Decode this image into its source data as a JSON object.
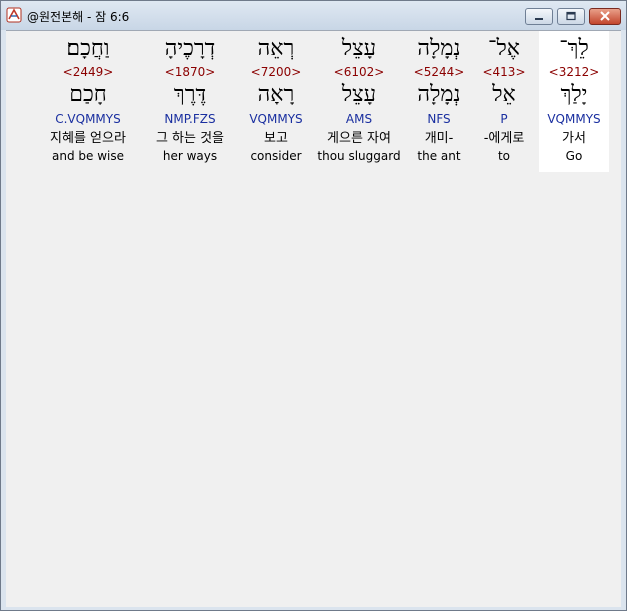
{
  "window": {
    "title": "@원전본해 - 잠 6:6",
    "icon": "app-logo-icon",
    "buttons": [
      "minimize-icon",
      "maximize-icon",
      "close-icon"
    ]
  },
  "colors": {
    "strong": "#8b0000",
    "morph": "#1a2fa0",
    "selected_bg": "#ffffff"
  },
  "words": [
    {
      "hebrew": "לֵךְ־",
      "strong": "<3212>",
      "lemma": "יָלַךְ",
      "morph": "VQMMYS",
      "korean": "가서",
      "english": "Go",
      "selected": true
    },
    {
      "hebrew": "אֶל־",
      "strong": "<413>",
      "lemma": "אֵל",
      "morph": "P",
      "korean": "-에게로",
      "english": "to",
      "selected": false
    },
    {
      "hebrew": "נְמָלָה",
      "strong": "<5244>",
      "lemma": "נְמָלָה",
      "morph": "NFS",
      "korean": "개미-",
      "english": "the ant",
      "selected": false
    },
    {
      "hebrew": "עָצֵל",
      "strong": "<6102>",
      "lemma": "עָצֵל",
      "morph": "AMS",
      "korean": "게으른 자여",
      "english": "thou sluggard",
      "selected": false
    },
    {
      "hebrew": "רְאֵה",
      "strong": "<7200>",
      "lemma": "רָאָה",
      "morph": "VQMMYS",
      "korean": "보고",
      "english": "consider",
      "selected": false
    },
    {
      "hebrew": "דְרָכֶיהָ",
      "strong": "<1870>",
      "lemma": "דֶּרֶךְ",
      "morph": "NMP.FZS",
      "korean": "그 하는 것을",
      "english": "her ways",
      "selected": false
    },
    {
      "hebrew": "וַחֲכָם׃",
      "strong": "<2449>",
      "lemma": "חָכַם",
      "morph": "C.VQMMYS",
      "korean": "지혜를 얻으라",
      "english": "and be wise",
      "selected": false
    }
  ]
}
